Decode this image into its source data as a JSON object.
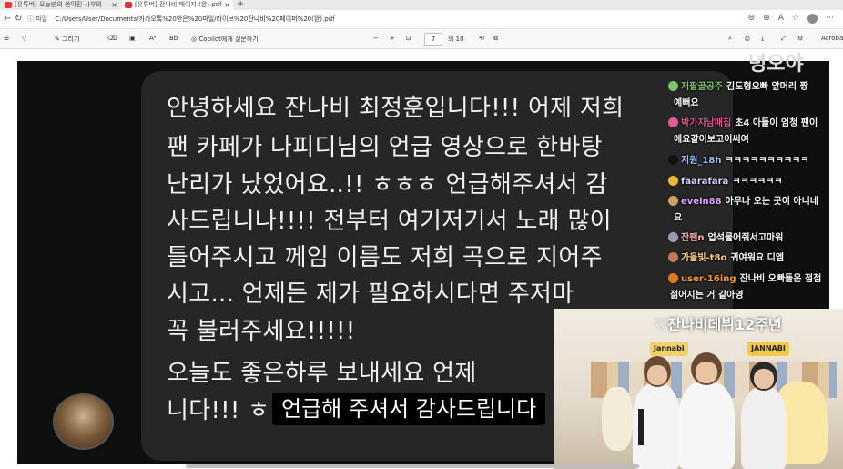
{
  "tabs": [
    {
      "label": "[유튜버] 오늘만의 쏟아진 사부의",
      "active": false
    },
    {
      "label": "[유튜버] 잔나비 페이지 (완).pdf",
      "active": true
    }
  ],
  "address": {
    "scheme_label": "파일",
    "url": "C:/Users/User/Documents/카카오톡%20받은%20파일/라이브%20잔나비%20페이퍼%20(완).pdf"
  },
  "pdf_toolbar": {
    "draw_label": "그리기",
    "copilot_label": "Copilot에게 질문하기",
    "page_current": "7",
    "page_total": "의 10",
    "acrobat_label": "Acrobat"
  },
  "slide": {
    "message_lines": [
      "안녕하세요 잔나비 최정훈입니다!!! 어제 저희",
      "팬 카페가 나피디님의 언급 영상으로 한바탕",
      "난리가 났었어요..!! ㅎㅎㅎ 언급해주셔서 감",
      "사드립니나!!!! 전부터 여기저기서 노래 많이",
      "틀어주시고 께임 이름도 저희 곡으로 지어주",
      "시고... 언제든 제가 필요하시다면 주저마",
      "꼭 불러주세요!!!!!",
      "오늘도 좋은하루 보내세요 언제",
      "니다!!!  ㅎ"
    ]
  },
  "watermark": "녕오야",
  "chat": [
    {
      "nick": "저팔골공주",
      "text": "김도형오빠 앞머리 짱",
      "color": "#7cc26e"
    },
    {
      "nick": "",
      "text": "예뻐요",
      "color": ""
    },
    {
      "nick": "박가지남매집",
      "text": "초4 아들이 엄청 팬이",
      "color": "#e05a9a"
    },
    {
      "nick": "",
      "text": "에요같이보고이써여",
      "color": ""
    },
    {
      "nick": "지원_18h",
      "text": "ㅋㅋㅋㅋㅋㅋㅋㅋㅋㅋ",
      "color": "#111111"
    },
    {
      "nick": "faarafara",
      "text": "ㅋㅋㅋㅋㅋㅋ",
      "color": "#f0b53a"
    },
    {
      "nick": "evein88",
      "text": "아무나 오는 곳이 아니네",
      "color": "#caa36a"
    },
    {
      "nick": "",
      "text": "요",
      "color": ""
    },
    {
      "nick": "잔팬n",
      "text": "업석물어줘서고마워",
      "color": "#9a9ab0"
    },
    {
      "nick": "가을빛-t8o",
      "text": "귀여워요 디엠",
      "color": "#c47a5a"
    },
    {
      "nick": "user-16ing",
      "text": "잔나비 오빠들은 점점",
      "color": "#e07a1f"
    },
    {
      "nick": "",
      "text": "젊어지는 거 같아영",
      "color": ""
    }
  ],
  "cam": {
    "banner": "♡잔나비데뷔12주년",
    "sign_left": "Jannabi",
    "sign_right": "JANNABI"
  },
  "subtitle": "언급해 주셔서 감사드립니다"
}
